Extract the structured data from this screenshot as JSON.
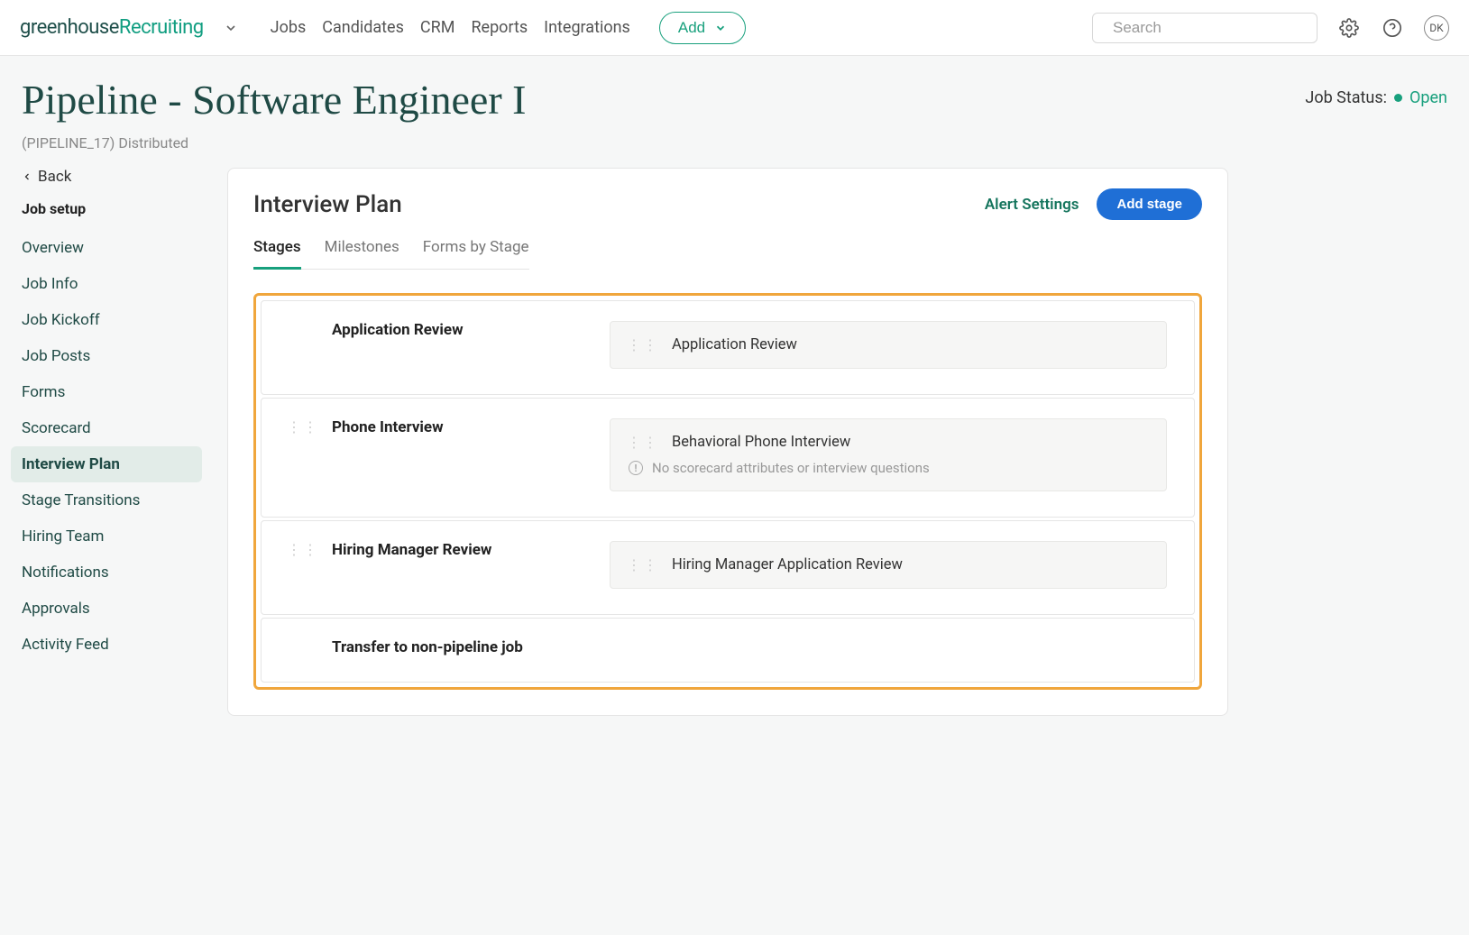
{
  "brand": {
    "part1": "greenhouse",
    "part2": "Recruiting"
  },
  "nav": {
    "items": [
      "Jobs",
      "Candidates",
      "CRM",
      "Reports",
      "Integrations"
    ],
    "add_label": "Add",
    "search_placeholder": "Search",
    "avatar_initials": "DK"
  },
  "page": {
    "title": "Pipeline - Software Engineer I",
    "subtitle": "(PIPELINE_17) Distributed",
    "status_label": "Job Status:",
    "status_value": "Open"
  },
  "sidebar": {
    "back_label": "Back",
    "heading": "Job setup",
    "items": [
      "Overview",
      "Job Info",
      "Job Kickoff",
      "Job Posts",
      "Forms",
      "Scorecard",
      "Interview Plan",
      "Stage Transitions",
      "Hiring Team",
      "Notifications",
      "Approvals",
      "Activity Feed"
    ],
    "active_index": 6
  },
  "card": {
    "title": "Interview Plan",
    "alert_settings": "Alert Settings",
    "add_stage": "Add stage",
    "tabs": [
      "Stages",
      "Milestones",
      "Forms by Stage"
    ],
    "active_tab": 0
  },
  "stages": [
    {
      "name": "Application Review",
      "draggable": false,
      "items": [
        {
          "label": "Application Review",
          "warning": null
        }
      ]
    },
    {
      "name": "Phone Interview",
      "draggable": true,
      "items": [
        {
          "label": "Behavioral Phone Interview",
          "warning": "No scorecard attributes or interview questions"
        }
      ]
    },
    {
      "name": "Hiring Manager Review",
      "draggable": true,
      "items": [
        {
          "label": "Hiring Manager Application Review",
          "warning": null
        }
      ]
    },
    {
      "name": "Transfer to non-pipeline job",
      "draggable": false,
      "items": []
    }
  ]
}
